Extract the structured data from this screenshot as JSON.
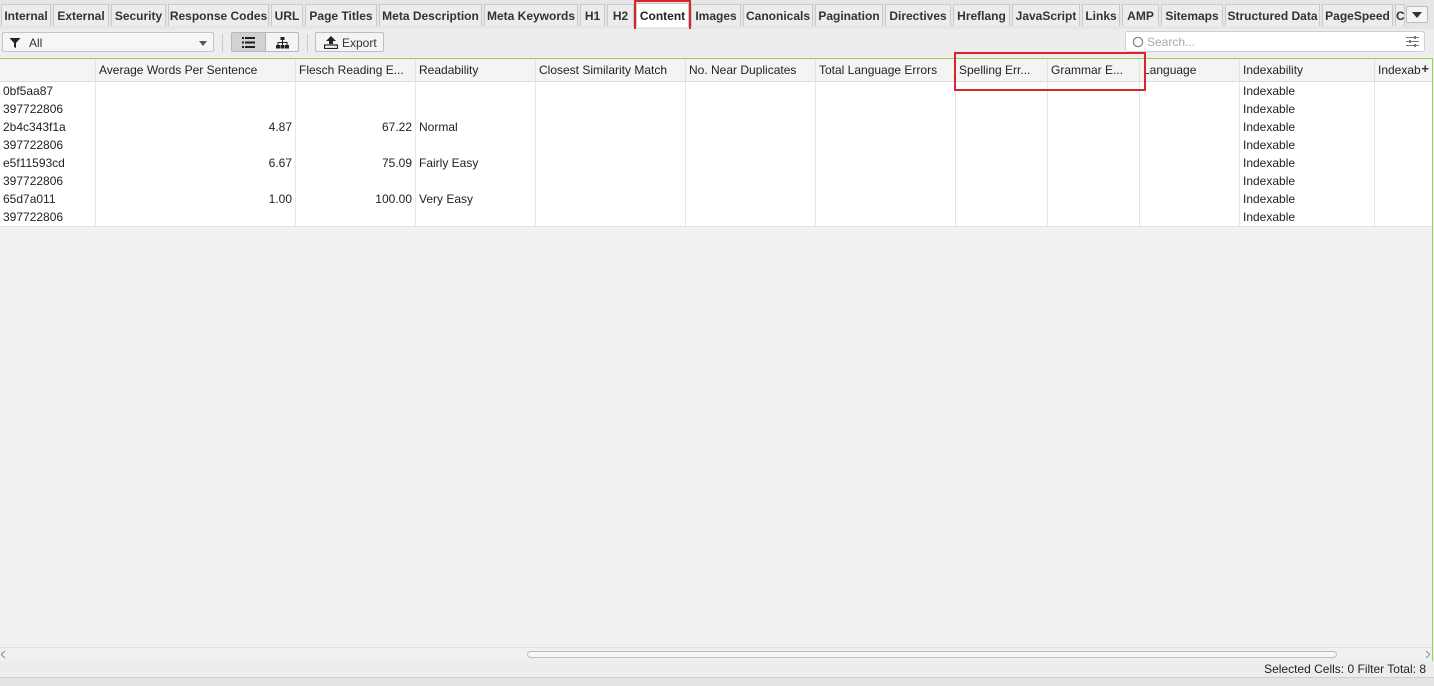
{
  "tabs": [
    {
      "label": "Internal",
      "active": false
    },
    {
      "label": "External",
      "active": false
    },
    {
      "label": "Security",
      "active": false
    },
    {
      "label": "Response Codes",
      "active": false
    },
    {
      "label": "URL",
      "active": false
    },
    {
      "label": "Page Titles",
      "active": false
    },
    {
      "label": "Meta Description",
      "active": false
    },
    {
      "label": "Meta Keywords",
      "active": false
    },
    {
      "label": "H1",
      "active": false
    },
    {
      "label": "H2",
      "active": false
    },
    {
      "label": "Content",
      "active": true
    },
    {
      "label": "Images",
      "active": false
    },
    {
      "label": "Canonicals",
      "active": false
    },
    {
      "label": "Pagination",
      "active": false
    },
    {
      "label": "Directives",
      "active": false
    },
    {
      "label": "Hreflang",
      "active": false
    },
    {
      "label": "JavaScript",
      "active": false
    },
    {
      "label": "Links",
      "active": false
    },
    {
      "label": "AMP",
      "active": false
    },
    {
      "label": "Sitemaps",
      "active": false
    },
    {
      "label": "Structured Data",
      "active": false
    },
    {
      "label": "PageSpeed",
      "active": false
    },
    {
      "label": "C",
      "active": false
    }
  ],
  "toolbar": {
    "filter_value": "All",
    "export_label": "Export",
    "search_placeholder": "Search..."
  },
  "table": {
    "columns": [
      "",
      "Average Words Per Sentence",
      "Flesch Reading E...",
      "Readability",
      "Closest Similarity Match",
      "No. Near Duplicates",
      "Total Language Errors",
      "Spelling Err...",
      "Grammar E...",
      "Language",
      "Indexability",
      "Indexab"
    ],
    "add_column_symbol": "+",
    "rows": [
      [
        "0bf5aa87",
        "",
        "",
        "",
        "",
        "",
        "",
        "",
        "",
        "",
        "Indexable",
        ""
      ],
      [
        "397722806",
        "",
        "",
        "",
        "",
        "",
        "",
        "",
        "",
        "",
        "Indexable",
        ""
      ],
      [
        "2b4c343f1a",
        "4.87",
        "67.22",
        "Normal",
        "",
        "",
        "",
        "",
        "",
        "",
        "Indexable",
        ""
      ],
      [
        "397722806",
        "",
        "",
        "",
        "",
        "",
        "",
        "",
        "",
        "",
        "Indexable",
        ""
      ],
      [
        "e5f11593cd",
        "6.67",
        "75.09",
        "Fairly Easy",
        "",
        "",
        "",
        "",
        "",
        "",
        "Indexable",
        ""
      ],
      [
        "397722806",
        "",
        "",
        "",
        "",
        "",
        "",
        "",
        "",
        "",
        "Indexable",
        ""
      ],
      [
        "65d7a011",
        "1.00",
        "100.00",
        "Very Easy",
        "",
        "",
        "",
        "",
        "",
        "",
        "Indexable",
        ""
      ],
      [
        "397722806",
        "",
        "",
        "",
        "",
        "",
        "",
        "",
        "",
        "",
        "Indexable",
        ""
      ]
    ]
  },
  "status": {
    "selected_cells_label": "Selected Cells:",
    "selected_cells_value": "0",
    "filter_total_label": "Filter Total:",
    "filter_total_value": "8"
  },
  "colors": {
    "highlight": "#d9262d",
    "grid_border": "#9ccf5a"
  }
}
